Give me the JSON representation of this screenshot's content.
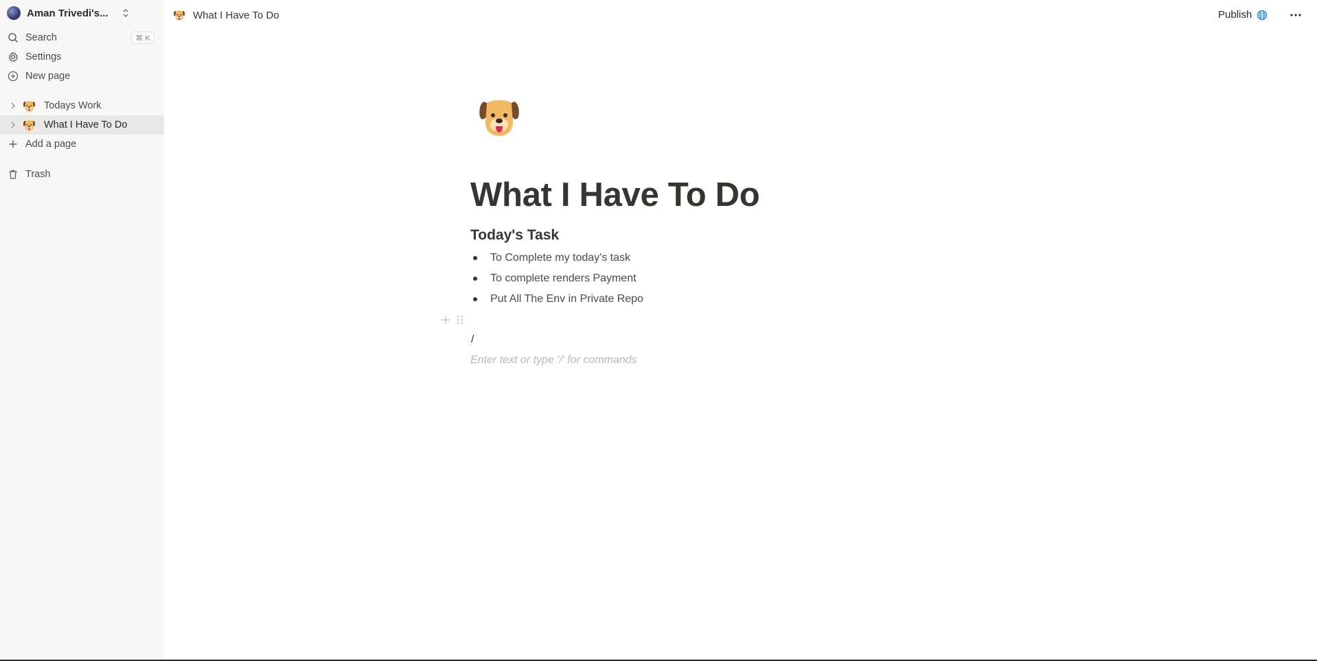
{
  "sidebar": {
    "workspace_name": "Aman Trivedi's...",
    "search_label": "Search",
    "search_shortcut": "⌘ K",
    "settings_label": "Settings",
    "new_page_label": "New page",
    "pages": [
      {
        "label": "Todays Work",
        "icon": "dog-emoji-icon",
        "active": false
      },
      {
        "label": "What I Have To Do",
        "icon": "dog-emoji-icon",
        "active": true
      }
    ],
    "add_page_label": "Add a page",
    "trash_label": "Trash"
  },
  "topbar": {
    "breadcrumb_title": "What I Have To Do",
    "publish_label": "Publish",
    "publish_icon": "globe-icon",
    "more_icon": "more-horizontal-icon"
  },
  "document": {
    "icon": "dog-emoji-icon",
    "title": "What I Have To Do",
    "heading": "Today's Task",
    "bullets": [
      "To Complete my today's task",
      "To complete renders Payment",
      "Put All The Env in Private Repo"
    ],
    "slash_text": "/",
    "placeholder": "Enter text or type '/' for commands"
  },
  "colors": {
    "sidebar_bg": "#f7f7f5",
    "active_row_bg": "#e8e8e6",
    "text_primary": "#37352f",
    "globe_blue": "#2383e2",
    "placeholder": "#b9b8b4"
  }
}
